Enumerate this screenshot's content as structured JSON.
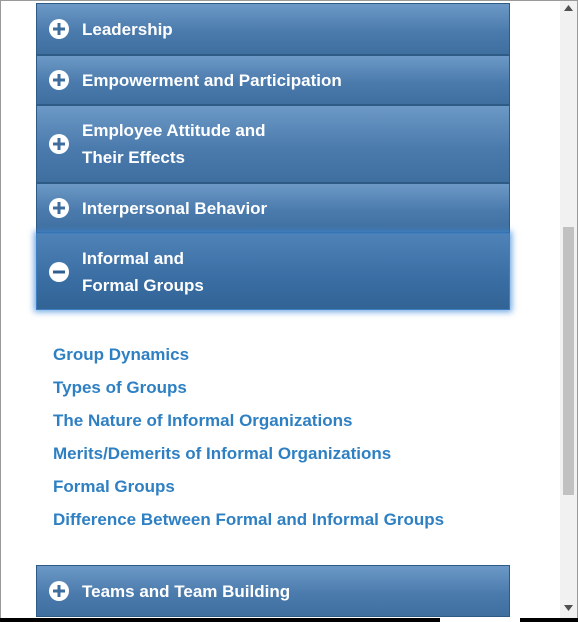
{
  "accordion": {
    "sections": [
      {
        "label_line1": "Leadership",
        "label_line2": "",
        "state": "collapsed"
      },
      {
        "label_line1": "Empowerment and Participation",
        "label_line2": "",
        "state": "collapsed"
      },
      {
        "label_line1": "Employee Attitude and",
        "label_line2": "Their Effects",
        "state": "collapsed"
      },
      {
        "label_line1": "Interpersonal Behavior",
        "label_line2": "",
        "state": "collapsed"
      },
      {
        "label_line1": "Informal and",
        "label_line2": "Formal Groups",
        "state": "expanded"
      },
      {
        "label_line1": "Teams and Team Building",
        "label_line2": "",
        "state": "collapsed"
      }
    ],
    "expanded_links": [
      "Group Dynamics",
      "Types of Groups",
      "The Nature of Informal Organizations",
      "Merits/Demerits of Informal Organizations",
      "Formal Groups",
      "Difference Between Formal and Informal Groups"
    ]
  },
  "icons": {
    "collapsed": "plus-circle-icon",
    "expanded": "minus-circle-icon",
    "scroll_up": "triangle-up-icon",
    "scroll_down": "triangle-down-icon"
  },
  "colors": {
    "panel_blue": "#4b7bad",
    "active_glow": "#428cdc",
    "link_blue": "#2f80c3"
  }
}
